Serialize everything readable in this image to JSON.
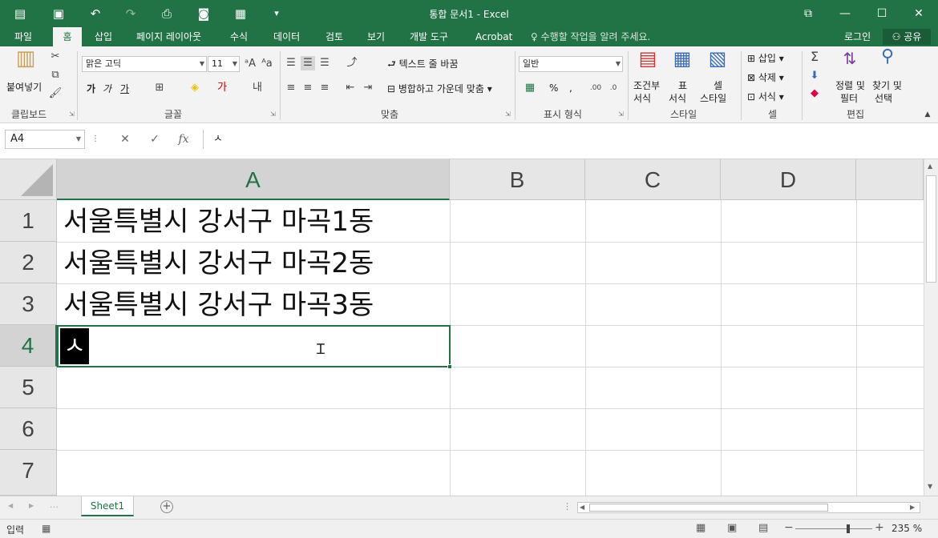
{
  "window": {
    "title": "통합 문서1 - Excel",
    "minimize": "—",
    "maximize": "☐",
    "close": "✕",
    "restore": "⧉"
  },
  "quick_access": {
    "save_icon": "💾",
    "undo_icon": "↶",
    "redo_icon": "↷",
    "customize_icon": "▾"
  },
  "tabs": [
    {
      "label": "파일"
    },
    {
      "label": "홈"
    },
    {
      "label": "삽입"
    },
    {
      "label": "페이지 레이아웃"
    },
    {
      "label": "수식"
    },
    {
      "label": "데이터"
    },
    {
      "label": "검토"
    },
    {
      "label": "보기"
    },
    {
      "label": "개발 도구"
    },
    {
      "label": "Acrobat"
    }
  ],
  "tell_me": "수행할 작업을 알려 주세요.",
  "login": "로그인",
  "share": "공유",
  "ribbon": {
    "clipboard": {
      "paste": "붙여넣기",
      "label": "클립보드"
    },
    "font": {
      "name": "맑은 고딕",
      "size": "11",
      "bold": "가",
      "italic": "가",
      "underline": "가",
      "label": "글꼴"
    },
    "align": {
      "wrap": "텍스트 줄 바꿈",
      "merge": "병합하고 가운데 맞춤",
      "label": "맞춤"
    },
    "number": {
      "format": "일반",
      "percent": "%",
      "comma": ",",
      "label": "표시 형식"
    },
    "styles": {
      "conditional": "조건부",
      "conditional2": "서식",
      "table": "표",
      "table2": "서식",
      "cell": "셀",
      "cell2": "스타일",
      "label": "스타일"
    },
    "cells": {
      "insert": "삽입",
      "delete": "삭제",
      "format": "서식",
      "label": "셀"
    },
    "editing": {
      "sort": "정렬 및",
      "sort2": "필터",
      "find": "찾기 및",
      "find2": "선택",
      "label": "편집"
    }
  },
  "formula_bar": {
    "name_box": "A4",
    "cancel": "✕",
    "enter": "✓",
    "fx": "fx",
    "content": "ㅅ"
  },
  "columns": [
    "A",
    "B",
    "C",
    "D"
  ],
  "rows": [
    "1",
    "2",
    "3",
    "4",
    "5",
    "6",
    "7"
  ],
  "cells": {
    "A1": "서울특별시 강서구 마곡1동",
    "A2": "서울특별시 강서구 마곡2동",
    "A3": "서울특별시 강서구 마곡3동",
    "A4": "ㅅ"
  },
  "active_cell": "A4",
  "sheets": [
    {
      "label": "Sheet1"
    }
  ],
  "status": {
    "mode": "입력",
    "zoom": "235 %"
  }
}
